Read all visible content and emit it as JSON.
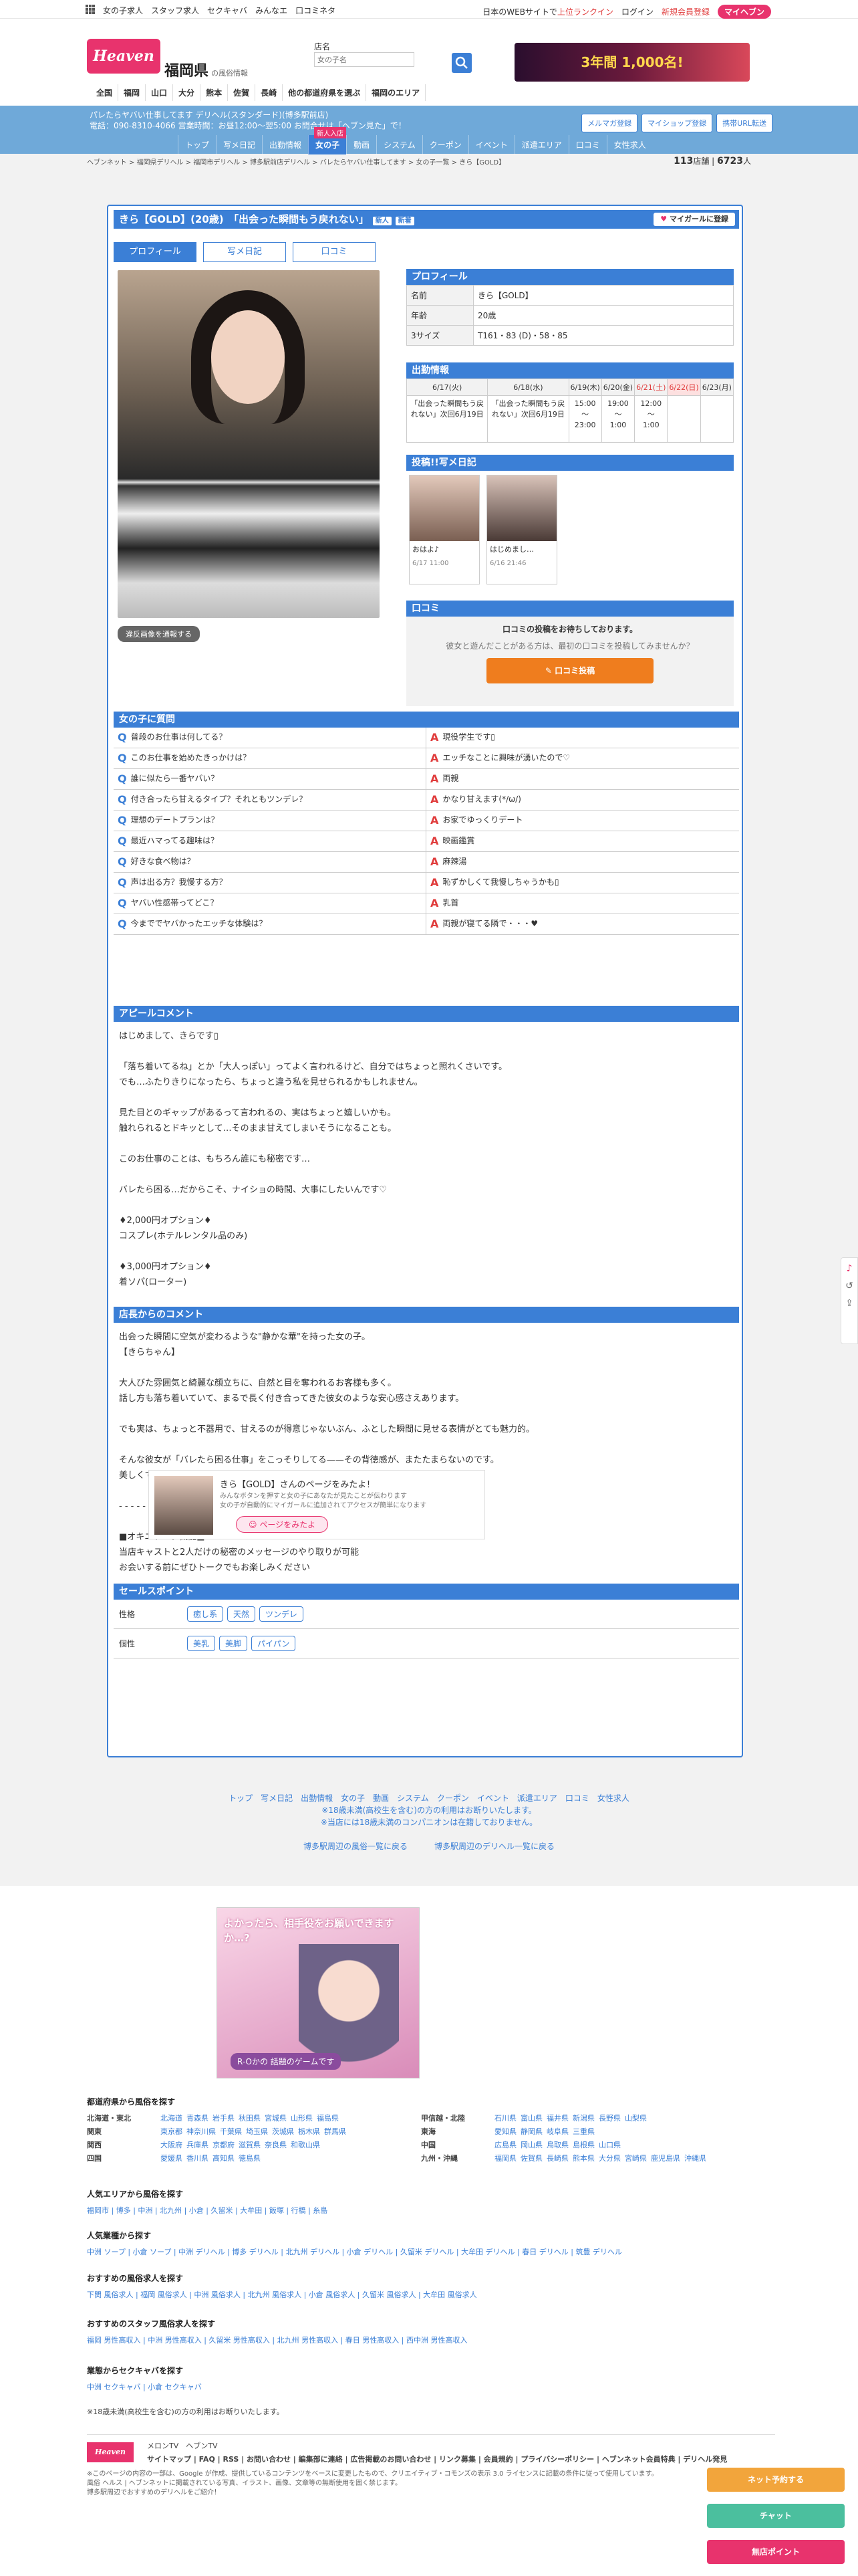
{
  "topbar": {
    "left": [
      "女の子求人",
      "スタッフ求人",
      "セクキャバ",
      "みんなエ",
      "口コミネタ"
    ],
    "right_prefix": "日本のWEBサイトで",
    "right_red": "上位ランクイン",
    "right_links": [
      "ログイン",
      "新規会員登録"
    ],
    "mypage": "マイヘブン"
  },
  "header": {
    "logo": "Heaven",
    "pref": "福岡県",
    "pref_sub": "の風俗情報",
    "search_label": "店名",
    "search_placeholder": "女の子名",
    "banner": "3年間 1,000名!",
    "cats": [
      "全国",
      "福岡",
      "山口",
      "大分",
      "熊本",
      "佐賀",
      "長崎",
      "他の都道府県を選ぶ",
      "福岡のエリア"
    ]
  },
  "subbar": {
    "line1": "パレたらヤバい仕事してます デリヘル(スタンダード)(博多駅前店)",
    "line2": "電話：090-8310-4066 営業時間：お昼12:00〜翌5:00 お問合せは「ヘブン見た」で！",
    "buttons": [
      "メルマガ登録",
      "マイショップ登録",
      "携帯URL転送"
    ],
    "new_badge": "新人入店",
    "tabs": [
      "トップ",
      "写メ日記",
      "出勤情報",
      "女の子",
      "動画",
      "システム",
      "クーポン",
      "イベント",
      "派遣エリア",
      "口コミ",
      "女性求人"
    ]
  },
  "crumbs": "ヘブンネット > 福岡県デリヘル > 福岡市デリヘル > 博多駅前店デリヘル > バレたらヤバい仕事してます > 女の子一覧 > きら【GOLD】",
  "stats": {
    "shops": "113",
    "shops_unit": "店舗",
    "girls": "6723",
    "girls_unit": "人"
  },
  "profile": {
    "title": "きら【GOLD】(20歳)　「出会った瞬間もう戻れない」",
    "tag1": "新人",
    "tag2": "新着",
    "mygirl": "マイガールに登録",
    "tabs": [
      "プロフィール",
      "写メ日記",
      "口コミ"
    ],
    "report": "違反画像を通報する",
    "head": "プロフィール",
    "rows": [
      {
        "k": "名前",
        "v": "きら【GOLD】"
      },
      {
        "k": "年齢",
        "v": "20歳"
      },
      {
        "k": "3サイズ",
        "v": "T161・83 (D)・58・85"
      }
    ]
  },
  "schedule": {
    "head": "出勤情報",
    "days": [
      "6/17(火)",
      "6/18(水)",
      "6/19(木)",
      "6/20(金)",
      "6/21(土)",
      "6/22(日)",
      "6/23(月)"
    ],
    "vals": [
      "「出会った瞬間もう戻れない」次回6月19日",
      "「出会った瞬間もう戻れない」次回6月19日",
      "15:00\n〜\n23:00",
      "19:00\n〜\n1:00",
      "12:00\n〜\n1:00",
      "",
      ""
    ]
  },
  "diary": {
    "head": "投稿!!写メ日記",
    "items": [
      {
        "t": "おはよ♪",
        "d": "6/17 11:00"
      },
      {
        "t": "はじめまし…",
        "d": "6/16 21:46"
      }
    ]
  },
  "kuchikomi": {
    "head": "口コミ",
    "bold": "口コミの投稿をお待ちしております。",
    "text": "彼女と遊んだことがある方は、最初の口コミを投稿してみませんか？",
    "btn": "✎ 口コミ投稿"
  },
  "qa": {
    "head": "女の子に質問",
    "items": [
      {
        "q": "普段のお仕事は何してる？",
        "a": "現役学生です▯"
      },
      {
        "q": "このお仕事を始めたきっかけは？",
        "a": "エッチなことに興味が湧いたので♡"
      },
      {
        "q": "誰に似たら一番ヤバい？",
        "a": "両親"
      },
      {
        "q": "付き合ったら甘えるタイプ？それともツンデレ？",
        "a": "かなり甘えます(*/ω/)"
      },
      {
        "q": "理想のデートプランは？",
        "a": "お家でゆっくりデート"
      },
      {
        "q": "最近ハマってる趣味は？",
        "a": "映画鑑賞"
      },
      {
        "q": "好きな食べ物は？",
        "a": "麻辣湯"
      },
      {
        "q": "声は出る方？我慢する方？",
        "a": "恥ずかしくて我慢しちゃうかも▯"
      },
      {
        "q": "ヤバい性感帯ってどこ？",
        "a": "乳首"
      },
      {
        "q": "今まででヤバかったエッチな体験は？",
        "a": "両親が寝てる隣で・・・♥"
      }
    ]
  },
  "appeal": {
    "head": "アピールコメント",
    "text": "はじめまして、きらです▯\n\n「落ち着いてるね」とか「大人っぽい」ってよく言われるけど、自分ではちょっと照れくさいです。\nでも…ふたりきりになったら、ちょっと違う私を見せられるかもしれません。\n\n見た目とのギャップがあるって言われるの、実はちょっと嬉しいかも。\n触れられるとドキッとして…そのまま甘えてしまいそうになることも。\n\nこのお仕事のことは、もちろん誰にも秘密です…\n\nバレたら困る…だからこそ、ナイショの時間、大事にしたいんです♡\n\n♦2,000円オプション♦\nコスプレ(ホテルレンタル品のみ)\n\n♦3,000円オプション♦\n着ソパ(ローター)"
  },
  "staff": {
    "head": "店長からのコメント",
    "text": "出会った瞬間に空気が変わるような\"静かな華\"を持った女の子。\n【きらちゃん】\n\n大人びた雰囲気と綺麗な顔立ちに、自然と目を奪われるお客様も多く。\n話し方も落ち着いていて、まるで長く付き合ってきた彼女のような安心感さえあります。\n\nでも実は、ちょっと不器用で、甘えるのが得意じゃないぶん、ふとした瞬間に見せる表情がとても魅力的。\n\nそんな彼女が「バレたら困る仕事」をこっそりしてる——その背徳感が、またたまらないのです。\n美しくて、危うい。そのバランスに、ハマる方が続出中です。\n\n- - - - - - - - - - - - - - - - - - - - - -\n\n■オキニトーク機能■\n当店キャストと2人だけの秘密のメッセージのやり取りが可能\nお会いする前にぜひトークでもお楽しみください"
  },
  "sales": {
    "head": "セールスポイント",
    "rows": [
      {
        "k": "性格",
        "tags": [
          "癒し系",
          "天然",
          "ツンデレ"
        ]
      },
      {
        "k": "個性",
        "tags": [
          "美乳",
          "美脚",
          "パイパン"
        ]
      }
    ]
  },
  "share": {
    "title": "きら【GOLD】さんのページをみたよ！",
    "sub": "みんなボタンを押すと女の子にあなたが見たことが伝わります\n女の子が自動的にマイガールに追加されてアクセスが簡単になります",
    "btn": "ページをみたよ"
  },
  "footer": {
    "links": [
      "トップ",
      "写メ日記",
      "出勤情報",
      "女の子",
      "動画",
      "システム",
      "クーポン",
      "イベント",
      "派遣エリア",
      "口コミ",
      "女性求人"
    ],
    "note1": "※18歳未満(高校生を含む)の方の利用はお断りいたします。",
    "note2": "※当店には18歳未満のコンパニオンは在籍しておりません。",
    "back1": "博多駅周辺の風俗一覧に戻る",
    "back2": "博多駅周辺のデリヘル一覧に戻る"
  },
  "ad": {
    "text": "よかったら、相手役をお願いできますか…?",
    "btn": "R-Oかの 話題のゲームです"
  },
  "bottom": {
    "h_pref": "都道府県から風俗を探す",
    "pref_left": [
      {
        "k": "北海道・東北",
        "v": [
          "北海道",
          "青森県",
          "岩手県",
          "秋田県",
          "宮城県",
          "山形県",
          "福島県"
        ]
      },
      {
        "k": "関東",
        "v": [
          "東京都",
          "神奈川県",
          "千葉県",
          "埼玉県",
          "茨城県",
          "栃木県",
          "群馬県"
        ]
      },
      {
        "k": "関西",
        "v": [
          "大阪府",
          "兵庫県",
          "京都府",
          "滋賀県",
          "奈良県",
          "和歌山県"
        ]
      },
      {
        "k": "四国",
        "v": [
          "愛媛県",
          "香川県",
          "高知県",
          "徳島県"
        ]
      }
    ],
    "pref_right": [
      {
        "k": "甲信越・北陸",
        "v": [
          "石川県",
          "富山県",
          "福井県",
          "新潟県",
          "長野県",
          "山梨県"
        ]
      },
      {
        "k": "東海",
        "v": [
          "愛知県",
          "静岡県",
          "岐阜県",
          "三重県"
        ]
      },
      {
        "k": "中国",
        "v": [
          "広島県",
          "岡山県",
          "鳥取県",
          "島根県",
          "山口県"
        ]
      },
      {
        "k": "九州・沖縄",
        "v": [
          "福岡県",
          "佐賀県",
          "長崎県",
          "熊本県",
          "大分県",
          "宮崎県",
          "鹿児島県",
          "沖縄県"
        ]
      }
    ],
    "h_area": "人気エリアから風俗を探す",
    "areas": "福岡市 | 博多 | 中洲 | 北九州 | 小倉 | 久留米 | 大牟田 | 飯塚 | 行橋 | 糸島",
    "h_genre": "人気業種から探す",
    "genres": "中洲 ソープ | 小倉 ソープ | 中洲 デリヘル | 博多 デリヘル | 北九州 デリヘル | 小倉 デリヘル | 久留米 デリヘル | 大牟田 デリヘル | 春日 デリヘル | 筑豊 デリヘル",
    "h_job": "おすすめの風俗求人を探す",
    "jobs": "下関 風俗求人 | 福岡 風俗求人 | 中洲 風俗求人 | 北九州 風俗求人 | 小倉 風俗求人 | 久留米 風俗求人 | 大牟田 風俗求人",
    "h_staff": "おすすめのスタッフ風俗求人を探す",
    "staffs": "福岡 男性高収入 | 中洲 男性高収入 | 久留米 男性高収入 | 北九州 男性高収入 | 春日 男性高収入 | 西中洲 男性高収入",
    "h_kyaba": "業態からセクキャバを探す",
    "kyaba": "中洲 セクキャバ | 小倉 セクキャバ",
    "age": "※18歳未満(高校生を含む)の方の利用はお断りいたします。",
    "meron": "メロンTV",
    "heaventv": "ヘブンTV",
    "sitemap": "サイトマップ | FAQ | RSS | お問い合わせ | 編集部に連絡 | 広告掲載のお問い合わせ | リンク募集 | 会員規約 | プライバシーポリシー | ヘブンネット会員特典 | デリヘル発見",
    "copy": "※このページの内容の一部は、Google が作成、提供しているコンテンツをベースに変更したもので、クリエイティブ・コモンズの表示 3.0 ライセンスに記載の条件に従って使用しています。",
    "copy2": "風俗 ヘルス | ヘブンネットに掲載されている写真、イラスト、画像、文章等の無断使用を固く禁じます。",
    "copy3": "博多駅周辺でおすすめのデリヘルをご紹介！"
  },
  "floats": [
    "ネット予約する",
    "チャット",
    "無店ポイント"
  ],
  "colors": {
    "accent": "#3b7fd6",
    "brand": "#e8336d",
    "orange": "#ef7d1e",
    "red": "#e03c3c"
  }
}
